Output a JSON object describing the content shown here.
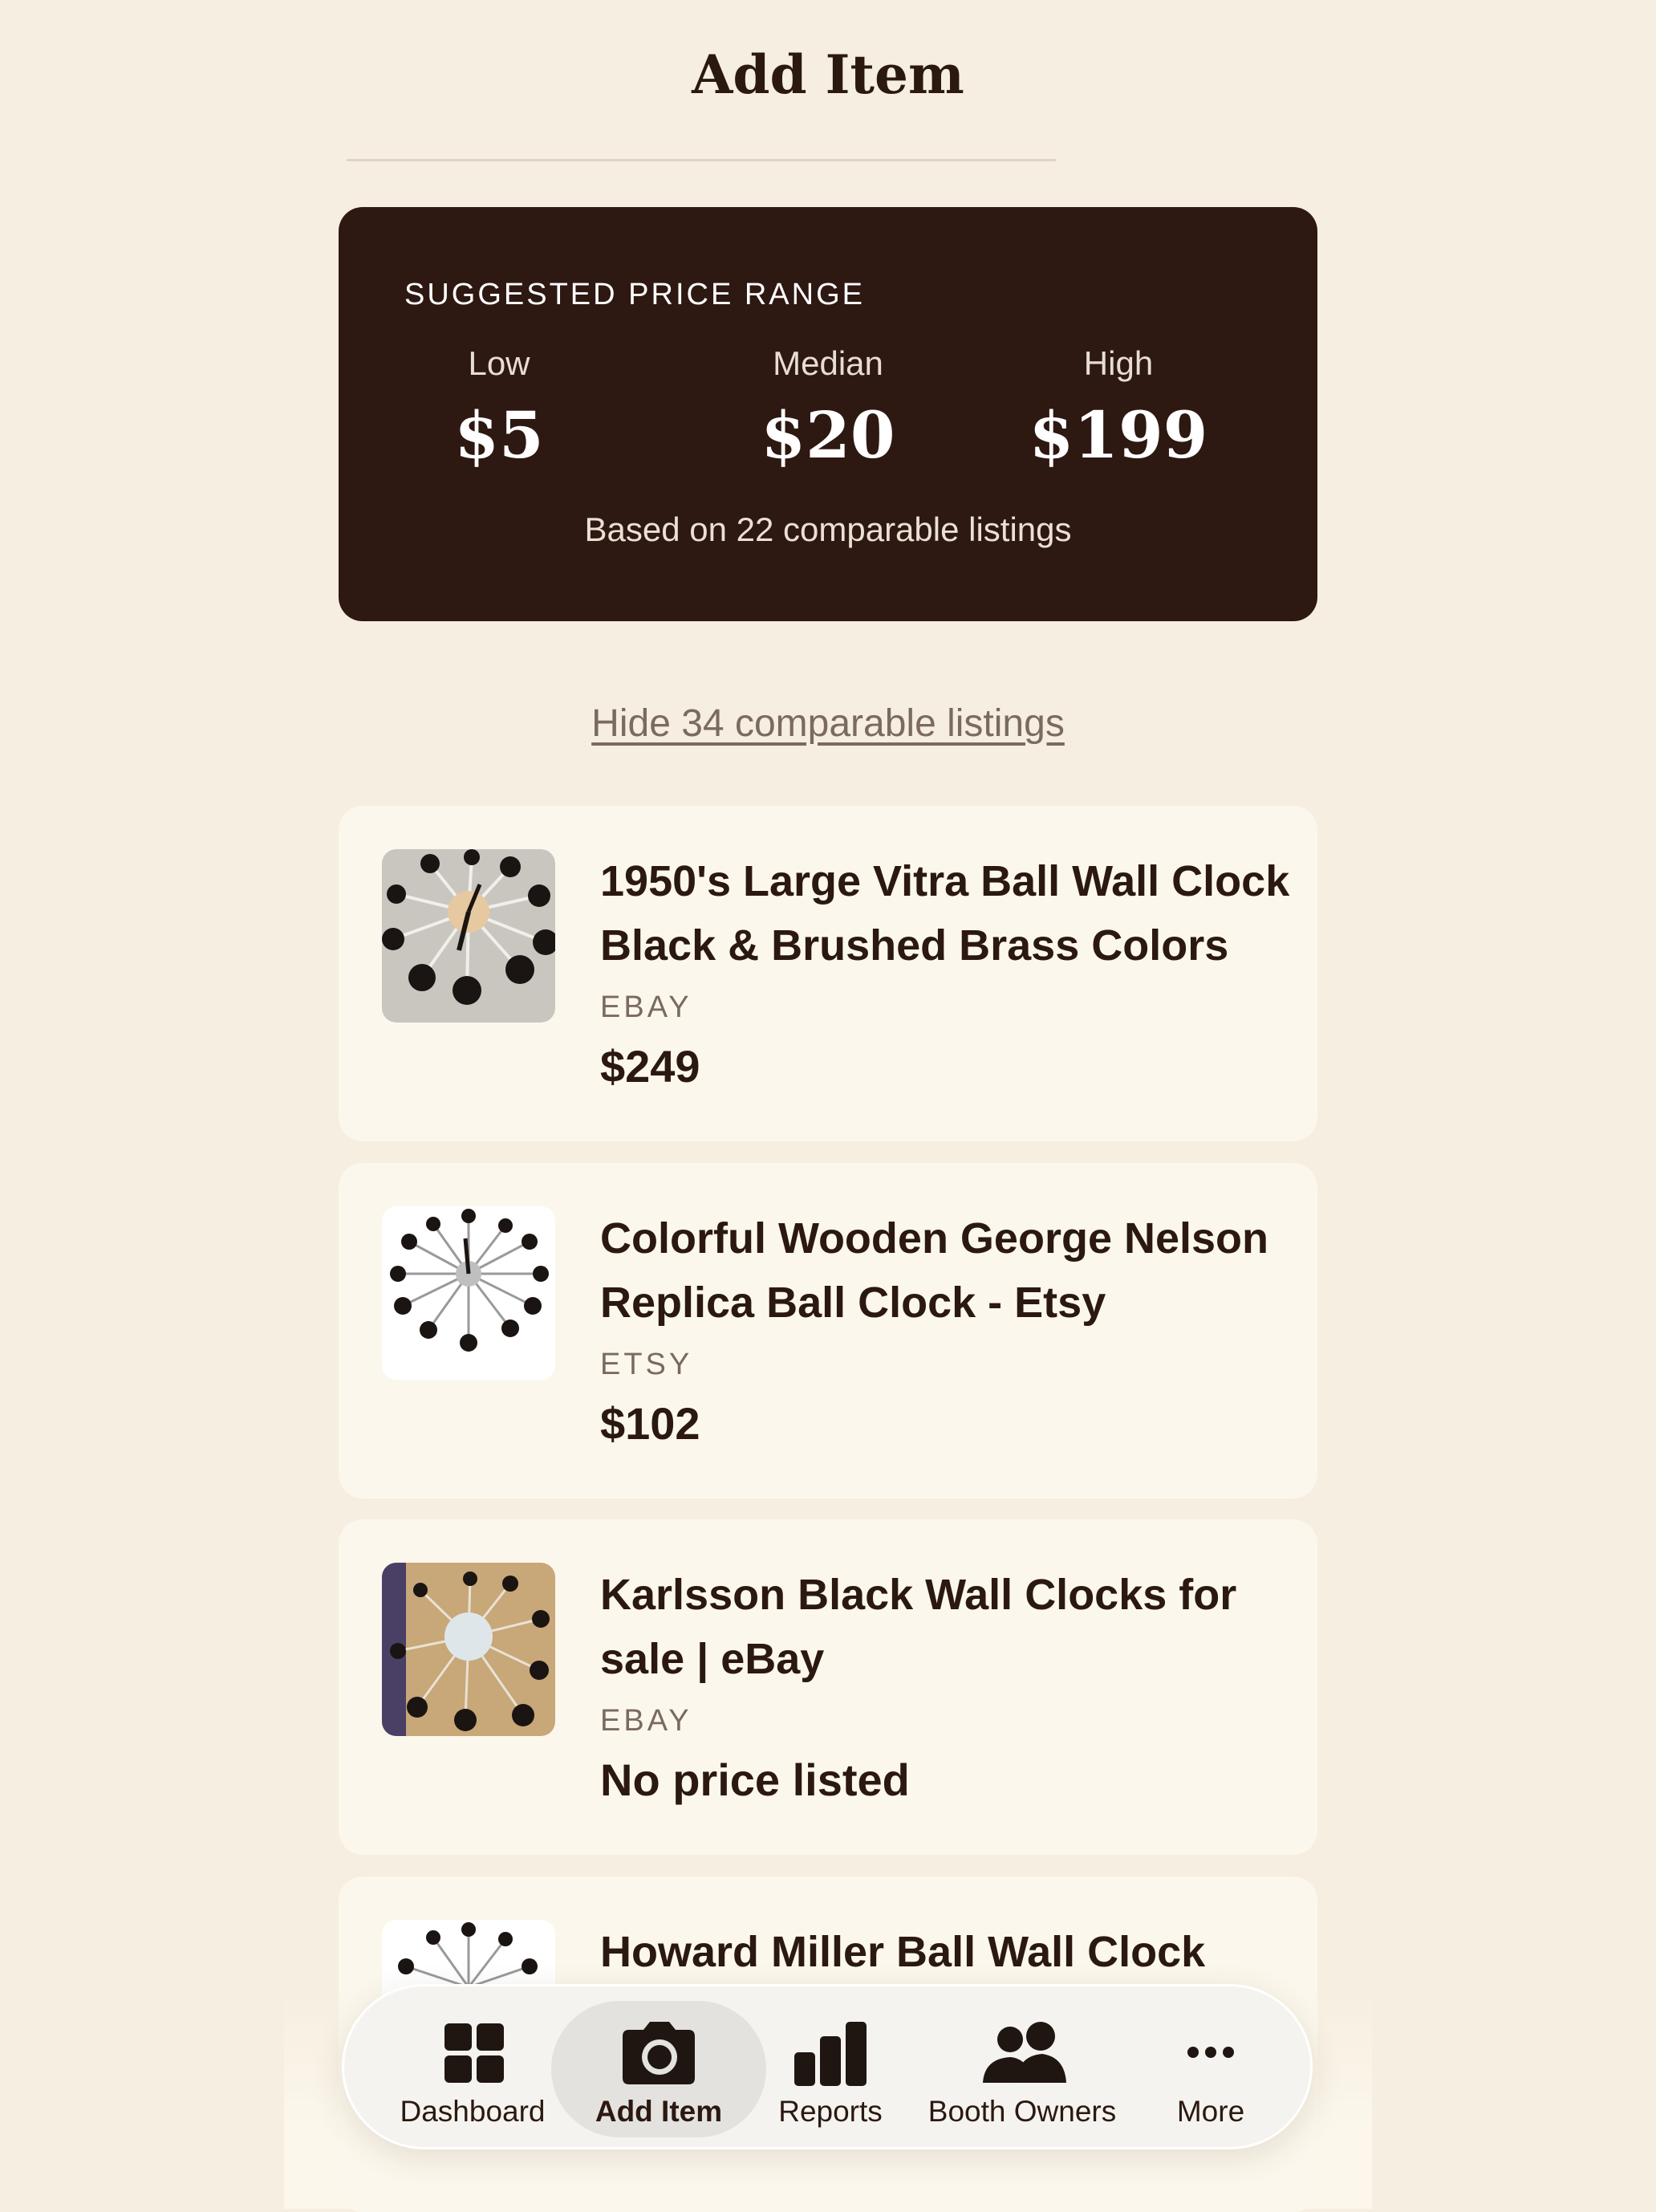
{
  "header": {
    "title": "Add Item"
  },
  "price_range": {
    "heading": "SUGGESTED PRICE RANGE",
    "low_label": "Low",
    "low_value": "$5",
    "median_label": "Median",
    "median_value": "$20",
    "high_label": "High",
    "high_value": "$199",
    "basis": "Based on 22 comparable listings"
  },
  "comparables_toggle": "Hide 34 comparable listings",
  "listings": [
    {
      "title": "1950's Large Vitra Ball Wall Clock Black & Brushed Brass Colors",
      "source": "EBAY",
      "price": "$249"
    },
    {
      "title": "Colorful Wooden George Nelson Replica Ball Clock - Etsy",
      "source": "ETSY",
      "price": "$102"
    },
    {
      "title": "Karlsson Black Wall Clocks for sale | eBay",
      "source": "EBAY",
      "price": "No price listed"
    },
    {
      "title": "Howard Miller Ball Wall Clock",
      "source": "",
      "price": ""
    }
  ],
  "tabbar": {
    "tabs": [
      {
        "label": "Dashboard",
        "icon": "grid-icon"
      },
      {
        "label": "Add Item",
        "icon": "camera-icon",
        "active": true
      },
      {
        "label": "Reports",
        "icon": "bar-chart-icon"
      },
      {
        "label": "Booth Owners",
        "icon": "people-icon"
      },
      {
        "label": "More",
        "icon": "more-icon"
      }
    ]
  },
  "colors": {
    "background": "#f6eee0",
    "card_dark": "#2e1812",
    "card_light": "#fcf7ec",
    "text_primary": "#2b1911",
    "text_muted": "#7a6a60"
  }
}
